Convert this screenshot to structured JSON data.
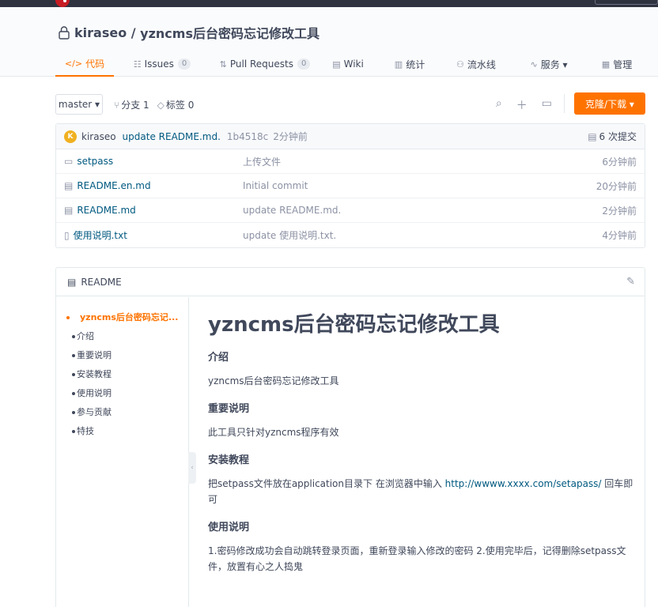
{
  "repo": {
    "owner": "kiraseo",
    "separator": " / ",
    "name": "yzncms后台密码忘记修改工具"
  },
  "tabs": [
    {
      "icon": "</>",
      "label": "代码"
    },
    {
      "icon": "☷",
      "label": "Issues",
      "count": "0"
    },
    {
      "icon": "⇅",
      "label": "Pull Requests",
      "count": "0"
    },
    {
      "icon": "▤",
      "label": "Wiki"
    },
    {
      "icon": "▥",
      "label": "统计"
    },
    {
      "icon": "⚇",
      "label": "流水线"
    },
    {
      "icon": "∿",
      "label": "服务 ▾"
    },
    {
      "icon": "▦",
      "label": "管理"
    }
  ],
  "toolbar": {
    "branch": "master ▾",
    "branches": "分支 1",
    "tags": "标签 0",
    "clone_label": "克隆/下载 ▾"
  },
  "commit": {
    "avatar_letter": "K",
    "author": "kiraseo",
    "message": "update README.md.",
    "hash": "1b4518c",
    "time": "2分钟前",
    "count": "6 次提交"
  },
  "files": [
    {
      "icon": "folder-icon",
      "glyph": "▭",
      "name": "setpass",
      "message": "上传文件",
      "time": "6分钟前"
    },
    {
      "icon": "markdown-file-icon",
      "glyph": "▤",
      "name": "README.en.md",
      "message": "Initial commit",
      "time": "20分钟前"
    },
    {
      "icon": "markdown-file-icon",
      "glyph": "▤",
      "name": "README.md",
      "message": "update README.md.",
      "time": "2分钟前"
    },
    {
      "icon": "text-file-icon",
      "glyph": "▯",
      "name": "使用说明.txt",
      "message": "update 使用说明.txt.",
      "time": "4分钟前"
    }
  ],
  "readme": {
    "title": "README",
    "toc": [
      "yzncms后台密码忘记...",
      "介绍",
      "重要说明",
      "安装教程",
      "使用说明",
      "参与贡献",
      "特技"
    ],
    "h1": "yzncms后台密码忘记修改工具",
    "sections": {
      "intro_title": "介绍",
      "intro_text": "yzncms后台密码忘记修改工具",
      "important_title": "重要说明",
      "important_text": "此工具只针对yzncms程序有效",
      "install_title": "安装教程",
      "install_text_before": "把setpass文件放在application目录下 在浏览器中输入 ",
      "install_link": "http://wwww.xxxx.com/setapass/",
      "install_text_after": " 回车即可",
      "usage_title": "使用说明",
      "usage_text": "1.密码修改成功会自动跳转登录页面，重新登录输入修改的密码 2.使用完毕后，记得删除setpass文件，放置有心之人捣鬼"
    }
  }
}
